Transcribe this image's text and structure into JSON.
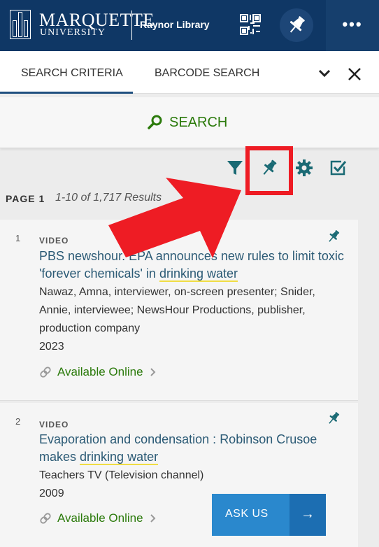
{
  "header": {
    "brand_name": "MARQUETTE",
    "brand_sub": "UNIVERSITY",
    "library_name": "Raynor Library",
    "qr_icon": "qr-code-icon",
    "pin_icon": "pushpin-icon",
    "more_label": "•••"
  },
  "tabs": {
    "search_criteria": "SEARCH CRITERIA",
    "barcode_search": "BARCODE SEARCH",
    "close_label": "×"
  },
  "search": {
    "button_label": "SEARCH"
  },
  "toolbar": {
    "icons": [
      "filter-icon",
      "pushpin-icon",
      "gear-icon",
      "checkbox-icon"
    ]
  },
  "results": {
    "page_label": "PAGE 1",
    "count_text": "1-10 of 1,717 Results",
    "items": [
      {
        "number": "1",
        "type": "VIDEO",
        "title_pre": "PBS newshour. EPA announces new rules to limit toxic 'forever chemicals' in ",
        "title_hl": "drinking water",
        "title_post": "",
        "authors": "Nawaz, Amna, interviewer, on-screen presenter; Snider, Annie, interviewee; NewsHour Productions, publisher, production company",
        "year": "2023",
        "availability": "Available Online"
      },
      {
        "number": "2",
        "type": "VIDEO",
        "title_pre": "Evaporation and condensation : Robinson Crusoe makes ",
        "title_hl": "drinking water",
        "title_post": "",
        "authors": "Teachers TV (Television channel)",
        "year": "2009",
        "availability": "Available Online"
      }
    ]
  },
  "ask_us": {
    "label": "ASK US",
    "arrow": "→"
  },
  "colors": {
    "header_bg": "#0f3765",
    "link_green": "#2b7a0b",
    "accent_teal": "#1a6a74",
    "annotation_red": "#ee1c24"
  }
}
